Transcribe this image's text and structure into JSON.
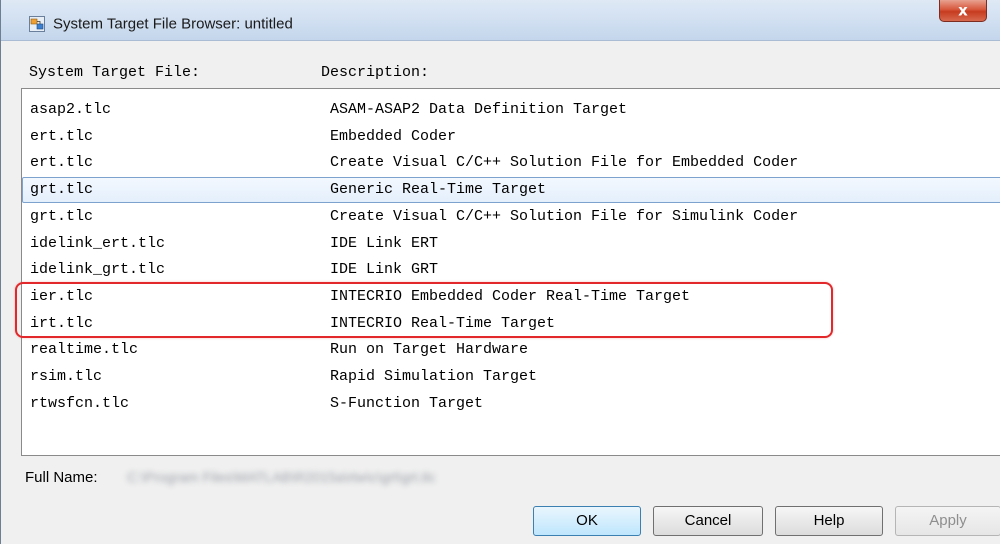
{
  "window": {
    "title": "System Target File Browser: untitled",
    "close_label": "x"
  },
  "columns": {
    "file": "System Target File:",
    "description": "Description:"
  },
  "rows": [
    {
      "file": "asap2.tlc",
      "description": "ASAM-ASAP2 Data Definition Target"
    },
    {
      "file": "ert.tlc",
      "description": "Embedded Coder"
    },
    {
      "file": "ert.tlc",
      "description": "Create Visual C/C++ Solution File for Embedded Coder"
    },
    {
      "file": "grt.tlc",
      "description": "Generic Real-Time Target",
      "selected": true
    },
    {
      "file": "grt.tlc",
      "description": "Create Visual C/C++ Solution File for Simulink Coder"
    },
    {
      "file": "idelink_ert.tlc",
      "description": "IDE Link ERT"
    },
    {
      "file": "idelink_grt.tlc",
      "description": "IDE Link GRT"
    },
    {
      "file": "ier.tlc",
      "description": "INTECRIO Embedded Coder Real-Time Target",
      "highlighted": true
    },
    {
      "file": "irt.tlc",
      "description": "INTECRIO Real-Time Target",
      "highlighted": true
    },
    {
      "file": "realtime.tlc",
      "description": "Run on Target Hardware"
    },
    {
      "file": "rsim.tlc",
      "description": "Rapid Simulation Target"
    },
    {
      "file": "rtwsfcn.tlc",
      "description": "S-Function Target"
    }
  ],
  "full_name": {
    "label": "Full Name:",
    "value": "C:\\Program Files\\MATLAB\\R2015a\\rtw\\c\\grt\\grt.tlc"
  },
  "buttons": {
    "ok": "OK",
    "cancel": "Cancel",
    "help": "Help",
    "apply": "Apply"
  },
  "colors": {
    "selection_border": "#7da2ce",
    "annotation_red": "#e2282a"
  }
}
